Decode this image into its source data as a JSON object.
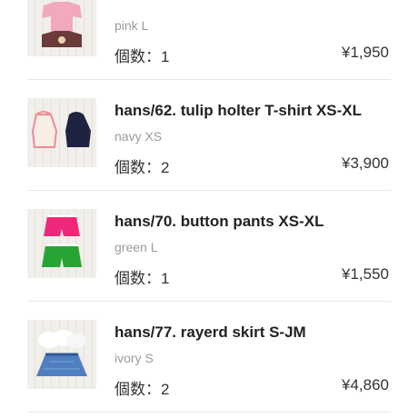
{
  "cart": {
    "items": [
      {
        "title": "",
        "variant": "pink L",
        "quantity": "個数：1",
        "price": "¥1,950",
        "thumbnail_icon": "t-shirt-pink-brown-icon"
      },
      {
        "title": "hans/62. tulip holter T-shirt XS-XL",
        "variant": "navy XS",
        "quantity": "個数：2",
        "price": "¥3,900",
        "thumbnail_icon": "halter-top-icon"
      },
      {
        "title": "hans/70. button pants XS-XL",
        "variant": "green L",
        "quantity": "個数：1",
        "price": "¥1,550",
        "thumbnail_icon": "shorts-pink-green-icon"
      },
      {
        "title": "hans/77. rayerd skirt S-JM",
        "variant": "ivory S",
        "quantity": "個数：2",
        "price": "¥4,860",
        "thumbnail_icon": "skirt-white-denim-icon"
      }
    ]
  },
  "colors": {
    "text": "#333333",
    "subtext": "#9a9a9a",
    "divider": "#e6e6e6"
  }
}
